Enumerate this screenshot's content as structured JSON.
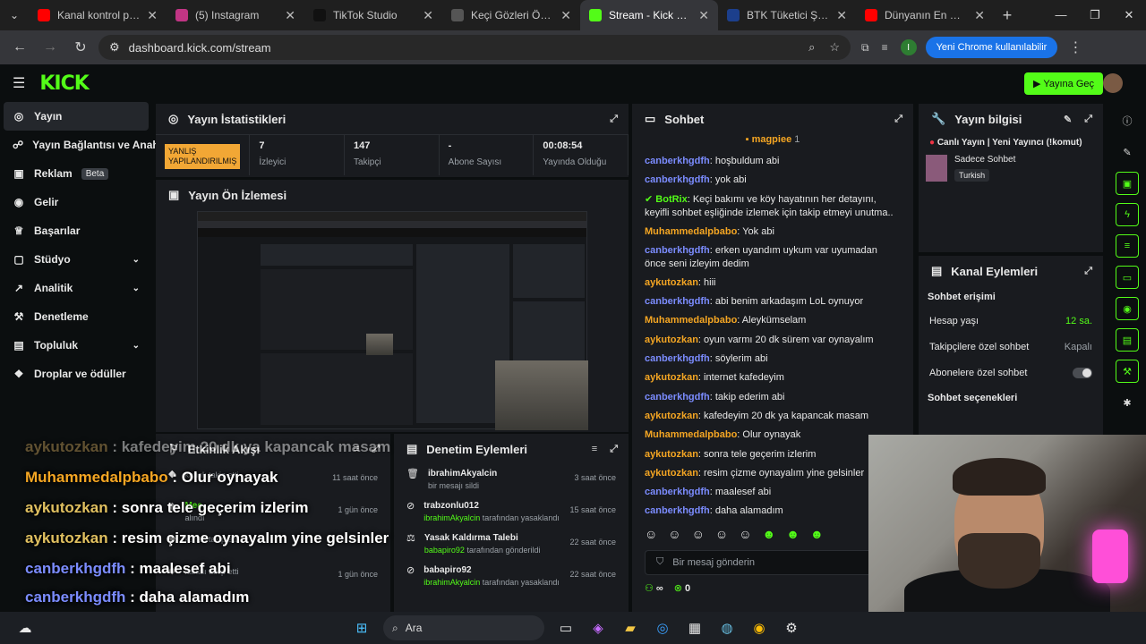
{
  "browser": {
    "tabs": [
      {
        "title": "Kanal kontrol paneli",
        "fav_color": "#ff0000"
      },
      {
        "title": "(5) Instagram",
        "fav_color": "#c13584"
      },
      {
        "title": "TikTok Studio",
        "fav_color": "#111111"
      },
      {
        "title": "Keçi Gözleri Özellikle",
        "fav_color": "#555555"
      },
      {
        "title": "Stream - Kick Dashb",
        "fav_color": "#53fc18"
      },
      {
        "title": "BTK Tüketici Şikayet",
        "fav_color": "#1c3f8c"
      },
      {
        "title": "Dünyanın En Gizli Ya",
        "fav_color": "#ff0000"
      }
    ],
    "url": "dashboard.kick.com/stream",
    "update_button": "Yeni Chrome kullanılabilir",
    "profile_initial": "I"
  },
  "kick": {
    "logo": "KICK",
    "go_live": "Yayına Geç"
  },
  "sidebar": {
    "items": [
      {
        "label": "Yayın",
        "icon": "◎"
      },
      {
        "label": "Yayın Bağlantısı ve Anahtar",
        "icon": "☍"
      },
      {
        "label": "Reklam",
        "icon": "▣",
        "badge": "Beta"
      },
      {
        "label": "Gelir",
        "icon": "◉"
      },
      {
        "label": "Başarılar",
        "icon": "♕"
      },
      {
        "label": "Stüdyo",
        "icon": "▢"
      },
      {
        "label": "Analitik",
        "icon": "↗"
      },
      {
        "label": "Denetleme",
        "icon": "⚒"
      },
      {
        "label": "Topluluk",
        "icon": "▤"
      },
      {
        "label": "Droplar ve ödüller",
        "icon": "❖"
      }
    ]
  },
  "stats_panel": {
    "title": "Yayın İstatistikleri",
    "warning": "YANLIŞ YAPILANDIRILMIŞ",
    "stats": [
      {
        "value": "7",
        "label": "İzleyici"
      },
      {
        "value": "147",
        "label": "Takipçi"
      },
      {
        "value": "-",
        "label": "Abone Sayısı"
      },
      {
        "value": "00:08:54",
        "label": "Yayında Olduğu"
      }
    ]
  },
  "preview_panel": {
    "title": "Yayın Ön İzlemesi"
  },
  "activity_panel": {
    "title": "Etkinlik Akışı",
    "items": [
      {
        "user": "",
        "action": "kanalı takip etti",
        "time": "11 saat önce"
      },
      {
        "user": "Mee",
        "action": "alındı",
        "time": "1 gün önce"
      },
      {
        "user": "",
        "action": "kanalı takip etti",
        "time": ""
      },
      {
        "user": "",
        "action": "kanalı takip etti",
        "time": "1 gün önce"
      }
    ]
  },
  "moderation_panel": {
    "title": "Denetim Eylemleri",
    "items": [
      {
        "title": "ibrahimAkyalcin",
        "detail": "bir mesajı sildi",
        "by": "",
        "time": "3 saat önce"
      },
      {
        "title": "trabzonlu012",
        "detail": "tarafından yasaklandı",
        "by": "ibrahimAkyalcin",
        "time": "15 saat önce"
      },
      {
        "title": "Yasak Kaldırma Talebi",
        "detail": "tarafından gönderildi",
        "by": "babapiro92",
        "time": "22 saat önce"
      },
      {
        "title": "babapiro92",
        "detail": "tarafından yasaklandı",
        "by": "ibrahimAkyalcin",
        "time": "22 saat önce"
      }
    ]
  },
  "chat_panel": {
    "title": "Sohbet",
    "pinned_user": "magpiee",
    "pinned_count": "1",
    "messages": [
      {
        "user": "canberkhgdfh",
        "color": "blue",
        "text": ": hoşbuldum abi"
      },
      {
        "user": "canberkhgdfh",
        "color": "blue",
        "text": ": yok abi"
      },
      {
        "user": "BotRix",
        "color": "green",
        "text": ": Keçi bakımı ve köy hayatının her detayını, keyifli sohbet eşliğinde izlemek için takip etmeyi unutma..",
        "wrap": true
      },
      {
        "user": "Muhammedalpbabo",
        "color": "orange",
        "text": ": Yok abi"
      },
      {
        "user": "canberkhgdfh",
        "color": "blue",
        "text": ": erken uyandım uykum var uyumadan önce seni izleyim dedim",
        "wrap": true
      },
      {
        "user": "aykutozkan",
        "color": "orange",
        "text": ": hiii"
      },
      {
        "user": "canberkhgdfh",
        "color": "blue",
        "text": ": abi benim arkadaşım LoL oynuyor"
      },
      {
        "user": "Muhammedalpbabo",
        "color": "orange",
        "text": ": Aleykümselam"
      },
      {
        "user": "aykutozkan",
        "color": "orange",
        "text": ": oyun varmı 20 dk sürem var oynayalım"
      },
      {
        "user": "canberkhgdfh",
        "color": "blue",
        "text": ": söylerim abi"
      },
      {
        "user": "aykutozkan",
        "color": "orange",
        "text": ": internet kafedeyim"
      },
      {
        "user": "canberkhgdfh",
        "color": "blue",
        "text": ": takip ederim abi"
      },
      {
        "user": "aykutozkan",
        "color": "orange",
        "text": ": kafedeyim 20 dk ya kapancak masam"
      },
      {
        "user": "Muhammedalpbabo",
        "color": "orange",
        "text": ": Olur oynayak"
      },
      {
        "user": "aykutozkan",
        "color": "orange",
        "text": ": sonra tele geçerim izlerim"
      },
      {
        "user": "aykutozkan",
        "color": "orange",
        "text": ": resim çizme oynayalım yine gelsinler"
      },
      {
        "user": "canberkhgdfh",
        "color": "blue",
        "text": ": maalesef abi"
      },
      {
        "user": "canberkhgdfh",
        "color": "blue",
        "text": ": daha alamadım"
      }
    ],
    "input_placeholder": "Bir mesaj gönderin",
    "footer_a": "∞",
    "footer_b": "0"
  },
  "info_panel": {
    "title": "Yayın bilgisi",
    "stream_title": "Canlı Yayın | Yeni Yayıncı (!komut)",
    "category": "Sadece Sohbet",
    "language": "Turkish"
  },
  "channel_actions": {
    "title": "Kanal Eylemleri",
    "section1": "Sohbet erişimi",
    "rows": [
      {
        "label": "Hesap yaşı",
        "value": "12 sa."
      },
      {
        "label": "Takipçilere özel sohbet",
        "value": "Kapalı"
      },
      {
        "label": "Abonelere özel sohbet",
        "value": ""
      }
    ],
    "section2": "Sohbet seçenekleri"
  },
  "overlay_chat": [
    {
      "user": "aykutozkan",
      "text": " : kafedeyim 20 dk ya kapancak masam",
      "color": "#c9a45c",
      "faded": true
    },
    {
      "user": "Muhammedalpbabo",
      "text": " : Olur oynayak",
      "color": "#f5a623"
    },
    {
      "user": "aykutozkan",
      "text": " : sonra tele geçerim izlerim",
      "color": "#e0c060"
    },
    {
      "user": "aykutozkan",
      "text": " : resim çizme oynayalım yine gelsinler",
      "color": "#e0c060"
    },
    {
      "user": "canberkhgdfh",
      "text": " : maalesef abi",
      "color": "#7b8cff"
    },
    {
      "user": "canberkhgdfh",
      "text": " : daha alamadım",
      "color": "#7b8cff"
    }
  ],
  "taskbar": {
    "search": "Ara"
  }
}
